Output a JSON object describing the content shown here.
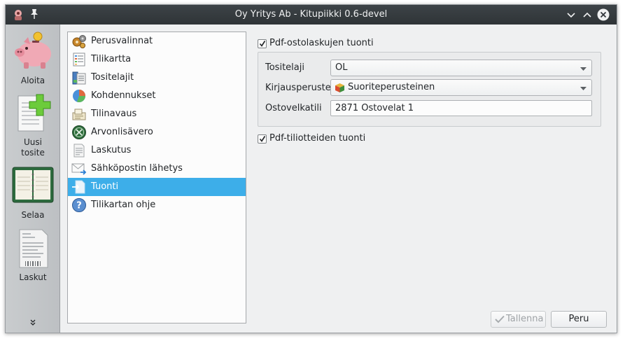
{
  "window": {
    "title": "Oy Yritys Ab - Kitupiikki 0.6-devel"
  },
  "sidebar": {
    "items": [
      {
        "label": "Aloita",
        "icon": "piggy-bank-icon"
      },
      {
        "label": "Uusi\ntosite",
        "icon": "new-voucher-icon"
      },
      {
        "label": "Selaa",
        "icon": "ledger-book-icon"
      },
      {
        "label": "Laskut",
        "icon": "invoice-icon"
      }
    ],
    "more_icon": "double-chevron-down-icon"
  },
  "categories": {
    "selected_index": 8,
    "items": [
      {
        "label": "Perusvalinnat",
        "icon": "basic-settings-icon"
      },
      {
        "label": "Tilikartta",
        "icon": "chart-of-accounts-icon"
      },
      {
        "label": "Tositelajit",
        "icon": "voucher-types-icon"
      },
      {
        "label": "Kohdennukset",
        "icon": "pie-chart-icon"
      },
      {
        "label": "Tilinavaus",
        "icon": "account-opening-icon"
      },
      {
        "label": "Arvonlisävero",
        "icon": "vat-icon"
      },
      {
        "label": "Laskutus",
        "icon": "invoicing-icon"
      },
      {
        "label": "Sähköpostin lähetys",
        "icon": "email-icon"
      },
      {
        "label": "Tuonti",
        "icon": "import-icon"
      },
      {
        "label": "Tilikartan ohje",
        "icon": "help-icon"
      }
    ]
  },
  "import_settings": {
    "purchase_invoices": {
      "label": "Pdf-ostolaskujen tuonti",
      "checked": true
    },
    "voucher_type": {
      "label": "Tositelaji",
      "value": "OL"
    },
    "booking_basis": {
      "label": "Kirjausperuste",
      "value": "Suoriteperusteinen",
      "icon": "box-icon"
    },
    "payables_account": {
      "label": "Ostovelkatili",
      "value": "2871 Ostovelat 1"
    },
    "bank_statements": {
      "label": "Pdf-tiliotteiden tuonti",
      "checked": true
    }
  },
  "buttons": {
    "save_label": "Tallenna",
    "back_label": "Peru"
  },
  "colors": {
    "titlebar": "#31363b",
    "selection": "#3daee9",
    "window_bg": "#eff0f1"
  }
}
